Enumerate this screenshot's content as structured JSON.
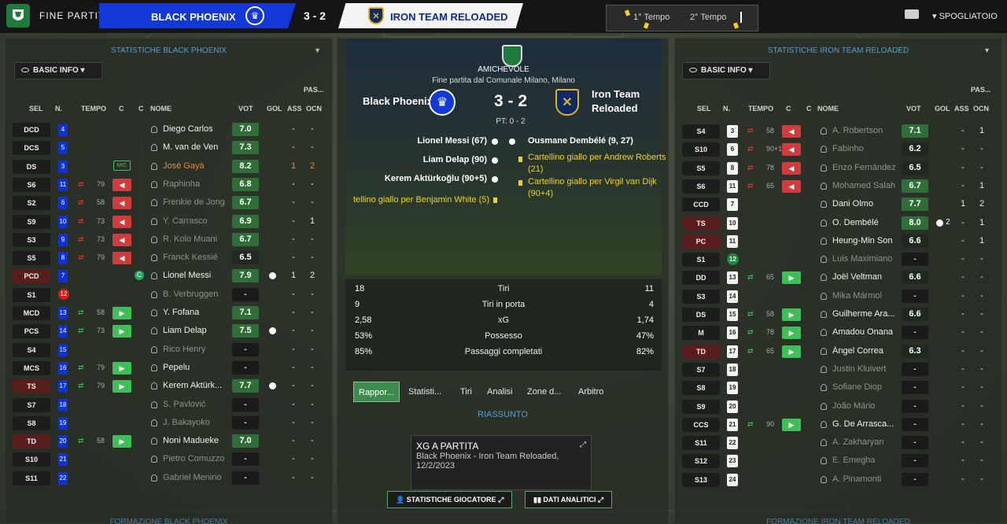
{
  "top": {
    "screen_title": "FINE PARTITA",
    "home_team": "BLACK PHOENIX",
    "score": "3 - 2",
    "away_team": "IRON TEAM RELOADED",
    "period1": "1° Tempo",
    "period2": "2° Tempo",
    "spogliatoio": "SPOGLIATOIO"
  },
  "left": {
    "title": "STATISTICHE BLACK PHOENIX",
    "view_button": "BASIC INFO",
    "headers": {
      "sel": "SEL",
      "n": "N.",
      "tempo": "TEMPO",
      "c1": "C",
      "c2": "C",
      "nome": "NOME",
      "vot": "VOT",
      "gol": "GOL",
      "ass": "ASS",
      "pas": "PAS...",
      "ocn": "OCN"
    },
    "footer": "FORMAZIONE BLACK PHOENIX",
    "rows": [
      {
        "role": "DCD",
        "num": "4",
        "name": "Diego Carlos",
        "rating": "7.0",
        "gol": "-",
        "ass": "-"
      },
      {
        "role": "DCS",
        "num": "5",
        "name": "M. van de Ven",
        "rating": "7.3",
        "gol": "-",
        "ass": "-"
      },
      {
        "role": "DS",
        "num": "3",
        "badge": "MIC",
        "name": "José Gayà",
        "rating": "8.2",
        "gol": "1",
        "ass": "2"
      },
      {
        "role": "S6",
        "num": "11",
        "min": "79",
        "name": "Raphinha",
        "rating": "6.8",
        "gol": "-",
        "ass": "-"
      },
      {
        "role": "S2",
        "num": "6",
        "min": "58",
        "name": "Frenkie de Jong",
        "rating": "6.7",
        "gol": "-",
        "ass": "-"
      },
      {
        "role": "S9",
        "num": "10",
        "min": "73",
        "name": "Y. Carrasco",
        "rating": "6.9",
        "gol": "-",
        "ass": "1"
      },
      {
        "role": "S3",
        "num": "9",
        "min": "73",
        "name": "R. Kolo Muani",
        "rating": "6.7",
        "gol": "-",
        "ass": "-"
      },
      {
        "role": "S5",
        "num": "8",
        "min": "79",
        "name": "Franck Kessié",
        "rating": "6.5",
        "gol": "-",
        "ass": "-"
      },
      {
        "role": "PCD",
        "num": "7",
        "cap": "C",
        "name": "Lionel Messi",
        "rating": "7.9",
        "gol": "1",
        "ass": "2"
      },
      {
        "role": "S1",
        "num": "12",
        "name": "B. Verbruggen",
        "rating": "-",
        "gol": "-",
        "ass": "-"
      },
      {
        "role": "MCD",
        "num": "13",
        "min": "58",
        "name": "Y. Fofana",
        "rating": "7.1",
        "gol": "-",
        "ass": "-"
      },
      {
        "role": "PCS",
        "num": "14",
        "min": "73",
        "name": "Liam Delap",
        "rating": "7.5",
        "gol": "-",
        "ass": "-"
      },
      {
        "role": "S4",
        "num": "15",
        "name": "Rico Henry",
        "rating": "-",
        "gol": "-",
        "ass": "-"
      },
      {
        "role": "MCS",
        "num": "16",
        "min": "79",
        "name": "Pepelu",
        "rating": "-",
        "gol": "-",
        "ass": "-"
      },
      {
        "role": "TS",
        "num": "17",
        "min": "79",
        "name": "Kerem Aktürk...",
        "rating": "7.7",
        "gol": "-",
        "ass": "-"
      },
      {
        "role": "S7",
        "num": "18",
        "name": "S. Pavlović",
        "rating": "-",
        "gol": "-",
        "ass": "-"
      },
      {
        "role": "S8",
        "num": "19",
        "name": "J. Bakayoko",
        "rating": "-",
        "gol": "-",
        "ass": "-"
      },
      {
        "role": "TD",
        "num": "20",
        "min": "58",
        "name": "Noni Madueke",
        "rating": "7.0",
        "gol": "-",
        "ass": "-"
      },
      {
        "role": "S10",
        "num": "21",
        "name": "Pietro Comuzzo",
        "rating": "-",
        "gol": "-",
        "ass": "-"
      },
      {
        "role": "S11",
        "num": "22",
        "name": "Gabriel Menino",
        "rating": "-",
        "gol": "-",
        "ass": "-"
      }
    ]
  },
  "center": {
    "competition": "AMICHEVOLE",
    "subtitle": "Fine partita dal Comunale Milano, Milano",
    "home_team": "Black Phoenix",
    "away_line1": "Iron Team",
    "away_line2": "Reloaded",
    "score": "3 - 2",
    "halftime": "PT: 0 - 2",
    "events_left": [
      "Lionel Messi (67)",
      "Liam Delap (90)",
      "Kerem Aktürkoğlu (90+5)"
    ],
    "event_right_goal": "Ousmane Dembélé (9, 27)",
    "event_right_yellow1": "Cartellino giallo per Andrew Roberts (21)",
    "event_right_yellow2": "Cartellino giallo per Virgil van Dijk (90+4)",
    "event_left_yellow": "tellino giallo per Benjamin White (5)",
    "stats": [
      {
        "home": "18",
        "label": "Tiri",
        "away": "11"
      },
      {
        "home": "9",
        "label": "Tiri in porta",
        "away": "4"
      },
      {
        "home": "2,58",
        "label": "xG",
        "away": "1,74"
      },
      {
        "home": "53%",
        "label": "Possesso",
        "away": "47%"
      },
      {
        "home": "85%",
        "label": "Passaggi completati",
        "away": "82%"
      }
    ],
    "tabs": [
      "Rappor...",
      "Statisti...",
      "Tiri",
      "Analisi",
      "Zone d...",
      "Arbitro"
    ],
    "riassunto": "RIASSUNTO",
    "xg_card": {
      "title": "XG A PARTITA",
      "line1": "Black Phoenix - Iron Team Reloaded,",
      "line2": "12/2/2023"
    },
    "btn_player_stats": "STATISTICHE GIOCATORE",
    "btn_analytics": "DATI ANALITICI"
  },
  "right": {
    "title": "STATISTICHE IRON TEAM RELOADED",
    "view_button": "BASIC INFO",
    "footer": "FORMAZIONE IRON TEAM RELOADED",
    "rows": [
      {
        "role": "S4",
        "num": "3",
        "min": "58",
        "name": "A. Robertson",
        "rating": "7.1",
        "gol": "-",
        "ass": "1"
      },
      {
        "role": "S10",
        "num": "6",
        "min": "90+1",
        "name": "Fabinho",
        "rating": "6.2",
        "gol": "-",
        "ass": "-"
      },
      {
        "role": "S5",
        "num": "8",
        "min": "78",
        "name": "Enzo Fernández",
        "rating": "6.5",
        "gol": "-",
        "ass": "-"
      },
      {
        "role": "S6",
        "num": "11",
        "min": "65",
        "name": "Mohamed Salah",
        "rating": "6.7",
        "gol": "-",
        "ass": "1"
      },
      {
        "role": "CCD",
        "num": "7",
        "name": "Dani Olmo",
        "rating": "7.7",
        "gol": "1",
        "ass": "2"
      },
      {
        "role": "TS",
        "num": "10",
        "name": "O. Dembélé",
        "rating": "8.0",
        "goals": "2",
        "gol": "-",
        "ass": "1"
      },
      {
        "role": "PC",
        "num": "11",
        "name": "Heung-Min Son",
        "rating": "6.6",
        "gol": "-",
        "ass": "1"
      },
      {
        "role": "S1",
        "num": "12",
        "name": "Luis Maximiano",
        "rating": "-",
        "gol": "-",
        "ass": "-"
      },
      {
        "role": "DD",
        "num": "13",
        "min": "65",
        "name": "Joël Veltman",
        "rating": "6.6",
        "gol": "-",
        "ass": "-"
      },
      {
        "role": "S3",
        "num": "14",
        "name": "Mika Mármol",
        "rating": "-",
        "gol": "-",
        "ass": "-"
      },
      {
        "role": "DS",
        "num": "15",
        "min": "58",
        "name": "Guilherme Ara...",
        "rating": "6.6",
        "gol": "-",
        "ass": "-"
      },
      {
        "role": "M",
        "num": "16",
        "min": "78",
        "name": "Amadou Onana",
        "rating": "-",
        "gol": "-",
        "ass": "-"
      },
      {
        "role": "TD",
        "num": "17",
        "min": "65",
        "name": "Ángel Correa",
        "rating": "6.3",
        "gol": "-",
        "ass": "-"
      },
      {
        "role": "S7",
        "num": "18",
        "name": "Justin Kluivert",
        "rating": "-",
        "gol": "-",
        "ass": "-"
      },
      {
        "role": "S8",
        "num": "19",
        "name": "Sofiane Diop",
        "rating": "-",
        "gol": "-",
        "ass": "-"
      },
      {
        "role": "S9",
        "num": "20",
        "name": "João Mário",
        "rating": "-",
        "gol": "-",
        "ass": "-"
      },
      {
        "role": "CCS",
        "num": "21",
        "min": "90",
        "name": "G. De Arrasca...",
        "rating": "-",
        "gol": "-",
        "ass": "-"
      },
      {
        "role": "S11",
        "num": "22",
        "name": "A. Zakharyan",
        "rating": "-",
        "gol": "-",
        "ass": "-"
      },
      {
        "role": "S12",
        "num": "23",
        "name": "E. Emegha",
        "rating": "-",
        "gol": "-",
        "ass": "-"
      },
      {
        "role": "S13",
        "num": "24",
        "name": "A. Pinamonti",
        "rating": "-",
        "gol": "-",
        "ass": "-"
      }
    ]
  }
}
